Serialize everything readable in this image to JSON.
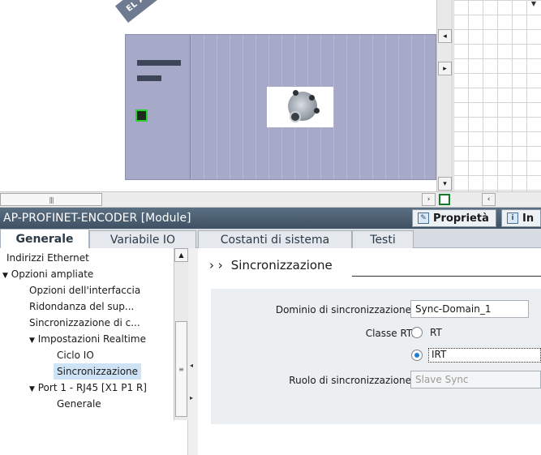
{
  "device_view": {
    "tag": "EL AP",
    "icons": [
      "encoder-icon",
      "ethernet-port-icon"
    ]
  },
  "panel": {
    "title": "AP-PROFINET-ENCODER [Module]",
    "tab_properties": "Proprietà",
    "tab_info": "In"
  },
  "tabs": {
    "general": "Generale",
    "io_variables": "Variabile IO",
    "system_constants": "Costanti di sistema",
    "texts": "Testi"
  },
  "tree": {
    "items": [
      {
        "label": "Indirizzi Ethernet",
        "expander": ""
      },
      {
        "label": "Opzioni ampliate",
        "expander": "▼"
      },
      {
        "label": "Opzioni dell'interfaccia",
        "expander": ""
      },
      {
        "label": "Ridondanza del sup...",
        "expander": ""
      },
      {
        "label": "Sincronizzazione di c...",
        "expander": ""
      },
      {
        "label": "Impostazioni Realtime",
        "expander": "▼"
      },
      {
        "label": "Ciclo IO",
        "expander": ""
      },
      {
        "label": "Sincronizzazione",
        "expander": ""
      },
      {
        "label": "Port 1 - RJ45 [X1 P1 R]",
        "expander": "▼"
      },
      {
        "label": "Generale",
        "expander": ""
      }
    ]
  },
  "content": {
    "breadcrumb_arrows": "› ›",
    "section_title": "Sincronizzazione",
    "sync_domain_label": "Dominio di sincronizzazione:",
    "sync_domain_value": "Sync-Domain_1",
    "rt_class_label": "Classe RT:",
    "rt_option": "RT",
    "irt_option": "IRT",
    "rt_selected": "IRT",
    "sync_role_label": "Ruolo di sincronizzazione:",
    "sync_role_value": "Slave Sync"
  },
  "colors": {
    "title_bar": "#4a5e71",
    "rack": "#a7a9c8",
    "port_border": "#2bd12b",
    "radio_selected": "#1e7fd6"
  }
}
